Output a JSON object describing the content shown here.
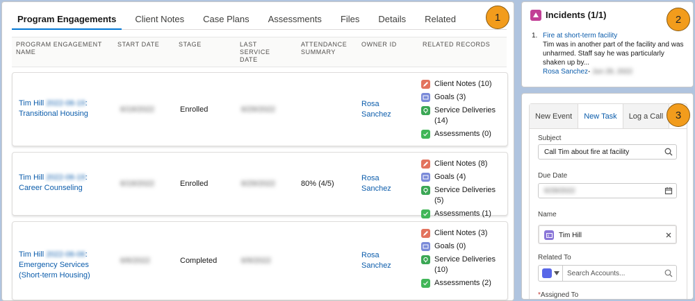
{
  "tabs": [
    "Program Engagements",
    "Client Notes",
    "Case Plans",
    "Assessments",
    "Files",
    "Details",
    "Related"
  ],
  "columns": {
    "name": "PROGRAM ENGAGEMENT NAME",
    "start": "START DATE",
    "stage": "STAGE",
    "last": "LAST SERVICE DATE",
    "attendance": "ATTENDANCE SUMMARY",
    "owner": "OWNER ID",
    "related": "RELATED RECORDS"
  },
  "rows": [
    {
      "name_prefix": "Tim Hill",
      "name_date": "2022-06-19",
      "name_suffix": ": Transitional Housing",
      "start": "6/19/2022",
      "stage": "Enrolled",
      "last": "6/29/2022",
      "attendance": "",
      "owner": "Rosa Sanchez",
      "related": [
        "Client Notes (10)",
        "Goals (3)",
        "Service Deliveries (14)",
        "Assessments (0)"
      ]
    },
    {
      "name_prefix": "Tim Hill",
      "name_date": "2022-06-19",
      "name_suffix": ": Career Counseling",
      "start": "6/19/2022",
      "stage": "Enrolled",
      "last": "6/29/2022",
      "attendance": "80% (4/5)",
      "owner": "Rosa Sanchez",
      "related": [
        "Client Notes (8)",
        "Goals (4)",
        "Service Deliveries (5)",
        "Assessments (1)"
      ]
    },
    {
      "name_prefix": "Tim Hill",
      "name_date": "2022-06-06",
      "name_suffix": ": Emergency Services (Short-term Housing)",
      "start": "6/6/2022",
      "stage": "Completed",
      "last": "6/9/2022",
      "attendance": "",
      "owner": "Rosa Sanchez",
      "related": [
        "Client Notes (3)",
        "Goals (0)",
        "Service Deliveries (10)",
        "Assessments (2)"
      ]
    }
  ],
  "related_icons": [
    {
      "icon": "pencil-icon",
      "color": "#e3735e"
    },
    {
      "icon": "goals-icon",
      "color": "#7a8ad9"
    },
    {
      "icon": "service-delivery-icon",
      "color": "#3ba755"
    },
    {
      "icon": "assessment-icon",
      "color": "#41b658"
    }
  ],
  "badges": [
    "1",
    "2",
    "3"
  ],
  "incidents": {
    "title": "Incidents (1/1)",
    "number": "1.",
    "link": "Fire at short-term facility",
    "body": "Tim was in another part of the facility and was unharmed. Staff say he was particularly shaken up by...",
    "author": "Rosa Sanchez",
    "separator": "-",
    "date": "Jun 29, 2022",
    "icon_color": "#c23f96"
  },
  "activity": {
    "tabs": [
      "New Event",
      "New Task",
      "Log a Call"
    ],
    "subject_label": "Subject",
    "subject_value": "Call Tim about fire at facility",
    "due_label": "Due Date",
    "due_value": "6/29/2022",
    "name_label": "Name",
    "name_value": "Tim Hill",
    "related_label": "Related To",
    "related_placeholder": "Search Accounts...",
    "assigned_label": "Assigned To",
    "required_mark": "*"
  }
}
